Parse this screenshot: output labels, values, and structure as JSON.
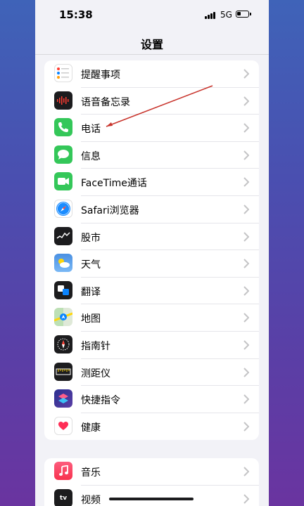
{
  "status_bar": {
    "time": "15:38",
    "network": "5G"
  },
  "nav": {
    "title": "设置"
  },
  "group1": {
    "items": [
      {
        "label": "提醒事项",
        "icon": "reminders-icon"
      },
      {
        "label": "语音备忘录",
        "icon": "voice-memos-icon"
      },
      {
        "label": "电话",
        "icon": "phone-icon"
      },
      {
        "label": "信息",
        "icon": "messages-icon"
      },
      {
        "label": "FaceTime通话",
        "icon": "facetime-icon"
      },
      {
        "label": "Safari浏览器",
        "icon": "safari-icon"
      },
      {
        "label": "股市",
        "icon": "stocks-icon"
      },
      {
        "label": "天气",
        "icon": "weather-icon"
      },
      {
        "label": "翻译",
        "icon": "translate-icon"
      },
      {
        "label": "地图",
        "icon": "maps-icon"
      },
      {
        "label": "指南针",
        "icon": "compass-icon"
      },
      {
        "label": "测距仪",
        "icon": "measure-icon"
      },
      {
        "label": "快捷指令",
        "icon": "shortcuts-icon"
      },
      {
        "label": "健康",
        "icon": "health-icon"
      }
    ]
  },
  "group2": {
    "items": [
      {
        "label": "音乐",
        "icon": "music-icon"
      },
      {
        "label": "视频",
        "icon": "tv-icon"
      }
    ]
  },
  "colors": {
    "annotation_arrow": "#c8332b",
    "chevron": "#c4c4c6"
  }
}
